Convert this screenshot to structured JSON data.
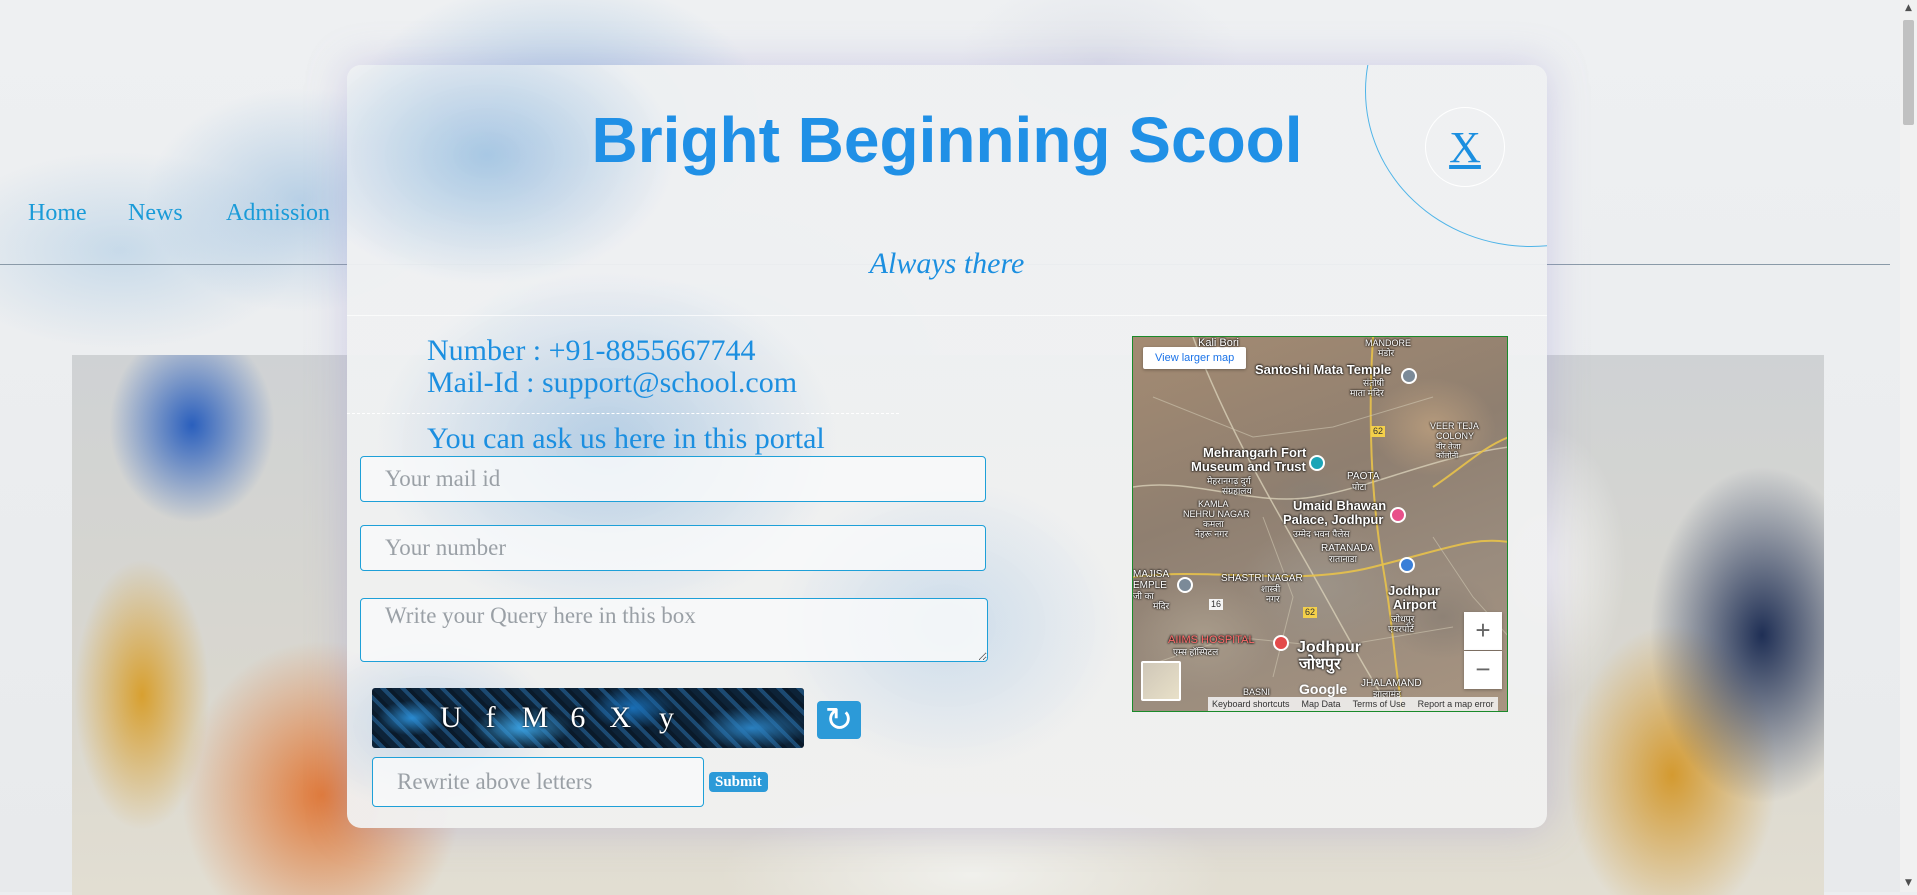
{
  "nav": {
    "items": [
      {
        "label": "Home"
      },
      {
        "label": "News"
      },
      {
        "label": "Admission"
      }
    ]
  },
  "modal": {
    "title": "Bright Beginning Scool",
    "close_label": "X",
    "tagline": "Always there",
    "contact": {
      "number": "Number : +91-8855667744",
      "mail": "Mail-Id : support@school.com"
    },
    "ask_text": "You can ask us here in this portal",
    "form": {
      "mail_placeholder": "Your mail id",
      "number_placeholder": "Your number",
      "query_placeholder": "Write your Query here in this box",
      "captcha_letters": [
        "U",
        "f",
        "M",
        "6",
        "X",
        "y"
      ],
      "rewrite_placeholder": "Rewrite above letters",
      "submit_label": "Submit"
    },
    "map": {
      "view_larger": "View larger map",
      "zoom_in": "+",
      "zoom_out": "−",
      "google": "Google",
      "attribution": [
        "Keyboard shortcuts",
        "Map Data",
        "Terms of Use",
        "Report a map error"
      ],
      "labels": {
        "kali_bori": "Kali Bori",
        "mandore": "MANDORE",
        "mandore_local": "मंडोर",
        "santoshi": "Santoshi Mata Temple",
        "santoshi_local1": "संतोषी",
        "santoshi_local2": "माता मंदिर",
        "veer_teja": "VEER TEJA",
        "colony": "COLONY",
        "veer_local": "वीर तेजा",
        "veer_local2": "कॉलोनी",
        "mehrangarh1": "Mehrangarh Fort",
        "mehrangarh2": "Museum and Trust",
        "mehrangarh3": "मेहरानगढ़ दुर्ग",
        "mehrangarh4": "संग्रहालय",
        "paota": "PAOTA",
        "paota_local": "पोटा",
        "kamla1": "KAMLA",
        "kamla2": "NEHRU NAGAR",
        "kamla3": "कमला",
        "kamla4": "नेहरू नगर",
        "umaid1": "Umaid Bhawan",
        "umaid2": "Palace, Jodhpur",
        "umaid3": "उम्मेद भवन पैलेस",
        "ratanada": "RATANADA",
        "ratanada_local": "रातानाडा",
        "majisa1": "MAJISA",
        "majisa2": "EMPLE",
        "majisa3": "जी का",
        "majisa4": "मंदिर",
        "shastri1": "SHASTRI NAGAR",
        "shastri2": "शास्त्री",
        "shastri3": "नगर",
        "airport1": "Jodhpur",
        "airport2": "Airport",
        "airport3": "जोधपुर",
        "airport4": "एयरपोर्ट",
        "aiims1": "AIIMS HOSPITAL",
        "aiims2": "एम्स हॉस्पिटल",
        "jodhpur1": "Jodhpur",
        "jodhpur2": "जोधपुर",
        "jhalamand": "JHALAMAND",
        "jhalamand_local": "झालामंड",
        "basni": "BASNI",
        "road62a": "62",
        "road62b": "62",
        "road16": "16"
      }
    }
  },
  "colors": {
    "accent": "#1c8fe0",
    "title": "#2090e6",
    "button": "#2c9ad8",
    "field_border": "#1ea0d8"
  }
}
